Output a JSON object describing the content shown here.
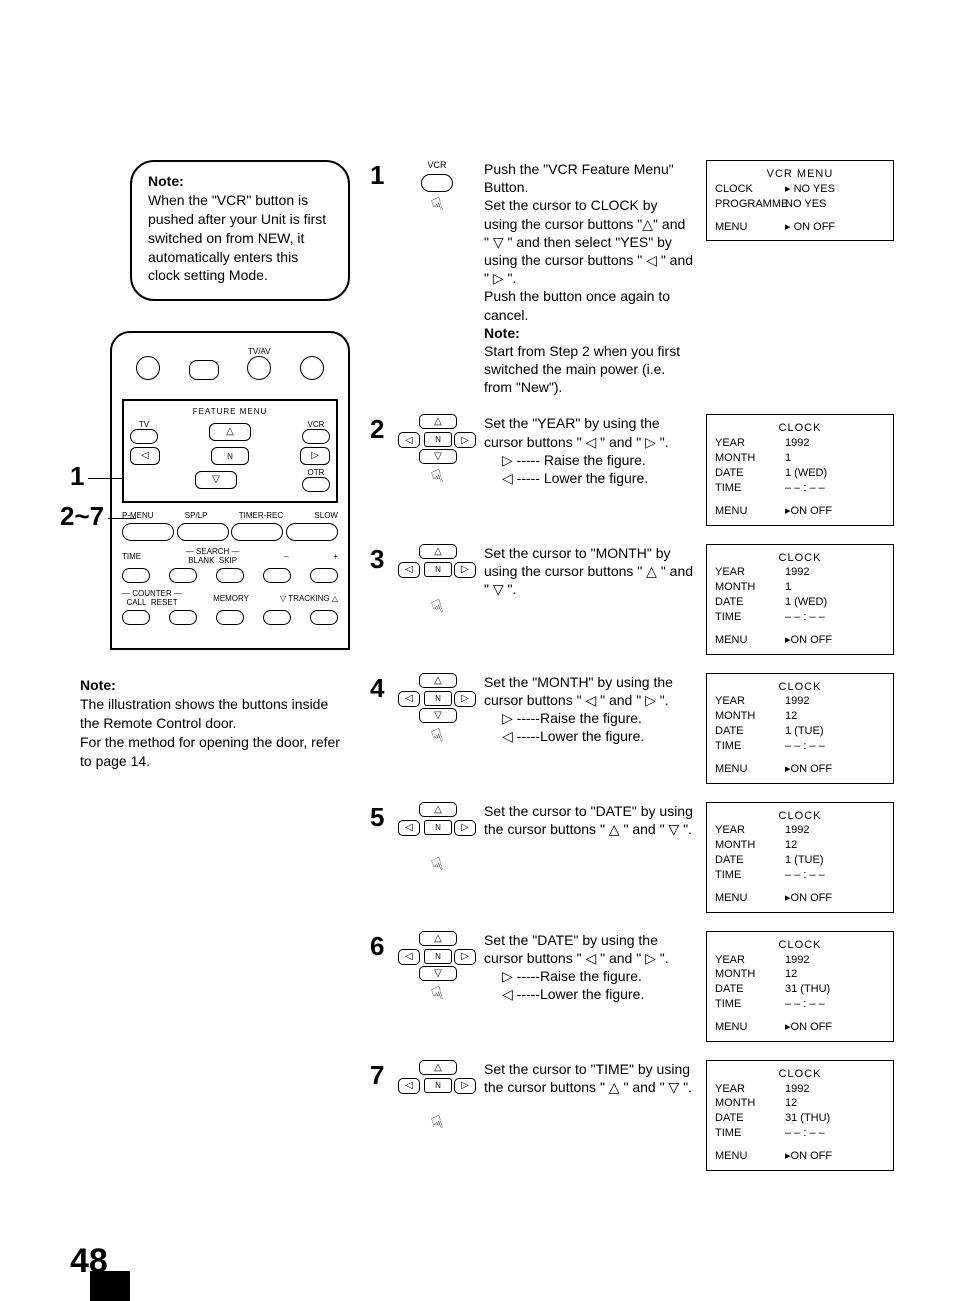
{
  "note_top": {
    "heading": "Note:",
    "body": "When the \"VCR\" button is pushed after your Unit is first switched on from NEW, it automatically enters this clock setting Mode."
  },
  "remote": {
    "tvav": "TV/AV",
    "feature_menu": "FEATURE MENU",
    "tv": "TV",
    "vcr": "VCR",
    "n": "N",
    "otr": "OTR",
    "pmenu": "P-MENU",
    "splp": "SP/LP",
    "timerrec": "TIMER-REC",
    "slow": "SLOW",
    "search": "SEARCH",
    "time": "TIME",
    "blank": "BLANK",
    "skip": "SKIP",
    "counter": "COUNTER",
    "call": "CALL",
    "reset": "RESET",
    "memory": "MEMORY",
    "tracking": "▽ TRACKING △"
  },
  "callout1": "1",
  "callout27": "2~7",
  "lower_note": {
    "heading": "Note:",
    "l1": "The illustration shows the buttons inside the Remote Control door.",
    "l2": "For the method for opening the door, refer to page 14."
  },
  "steps": {
    "s1": {
      "num": "1",
      "icon_label": "VCR",
      "text": "Push the \"VCR Feature Menu\" Button.\nSet the cursor to CLOCK by using the cursor buttons \"△\" and \" ▽ \" and then select \"YES\" by using the cursor buttons \" ◁ \" and \" ▷ \".\nPush the button once again to cancel.",
      "note_h": "Note:",
      "note": "Start from Step 2 when you first switched the main power (i.e. from \"New\")."
    },
    "s2": {
      "num": "2",
      "text": "Set the \"YEAR\" by using the cursor buttons \" ◁ \" and \" ▷ \".",
      "raise": "▷ ----- Raise the figure.",
      "lower": "◁ ----- Lower the figure."
    },
    "s3": {
      "num": "3",
      "text": "Set the cursor to \"MONTH\" by using the cursor buttons \" △ \" and \" ▽ \"."
    },
    "s4": {
      "num": "4",
      "text": "Set the \"MONTH\" by using the cursor buttons \" ◁ \" and \" ▷ \".",
      "raise": "▷ -----Raise the figure.",
      "lower": "◁ -----Lower the figure."
    },
    "s5": {
      "num": "5",
      "text": "Set the cursor to \"DATE\" by using the cursor buttons \" △ \" and \" ▽ \"."
    },
    "s6": {
      "num": "6",
      "text": "Set the \"DATE\" by using the cursor buttons \" ◁ \" and \" ▷ \".",
      "raise": "▷ -----Raise the figure.",
      "lower": "◁ -----Lower the figure."
    },
    "s7": {
      "num": "7",
      "text": "Set the cursor to \"TIME\" by using the cursor buttons \" △ \" and \" ▽ \"."
    }
  },
  "osd": {
    "s1": {
      "title": "VCR MENU",
      "r1l": "CLOCK",
      "r1v": "▸ NO  YES",
      "r2l": "PROGRAMME",
      "r2v": "  NO  YES",
      "menu_l": "MENU",
      "menu_v": "▸ ON  OFF"
    },
    "s2": {
      "title": "CLOCK",
      "year_l": "YEAR",
      "year_v": "1992",
      "month_l": "MONTH",
      "month_v": "1",
      "date_l": "DATE",
      "date_v": "1 (WED)",
      "time_l": "TIME",
      "time_v": "– – : – –",
      "menu_l": "MENU",
      "menu_v": "▸ON OFF"
    },
    "s3": {
      "title": "CLOCK",
      "year_l": "YEAR",
      "year_v": "1992",
      "month_l": "MONTH",
      "month_v": "1",
      "date_l": "DATE",
      "date_v": "1 (WED)",
      "time_l": "TIME",
      "time_v": "– – : – –",
      "menu_l": "MENU",
      "menu_v": "▸ON OFF"
    },
    "s4": {
      "title": "CLOCK",
      "year_l": "YEAR",
      "year_v": "1992",
      "month_l": "MONTH",
      "month_v": "12",
      "date_l": "DATE",
      "date_v": "1 (TUE)",
      "time_l": "TIME",
      "time_v": "– – : – –",
      "menu_l": "MENU",
      "menu_v": "▸ON OFF"
    },
    "s5": {
      "title": "CLOCK",
      "year_l": "YEAR",
      "year_v": "1992",
      "month_l": "MONTH",
      "month_v": "12",
      "date_l": "DATE",
      "date_v": "1 (TUE)",
      "time_l": "TIME",
      "time_v": "– – : – –",
      "menu_l": "MENU",
      "menu_v": "▸ON OFF"
    },
    "s6": {
      "title": "CLOCK",
      "year_l": "YEAR",
      "year_v": "1992",
      "month_l": "MONTH",
      "month_v": "12",
      "date_l": "DATE",
      "date_v": "31 (THU)",
      "time_l": "TIME",
      "time_v": "– – : – –",
      "menu_l": "MENU",
      "menu_v": "▸ON OFF"
    },
    "s7": {
      "title": "CLOCK",
      "year_l": "YEAR",
      "year_v": "1992",
      "month_l": "MONTH",
      "month_v": "12",
      "date_l": "DATE",
      "date_v": "31 (THU)",
      "time_l": "TIME",
      "time_v": "– – : – –",
      "menu_l": "MENU",
      "menu_v": "▸ON OFF"
    }
  },
  "page_number": "48",
  "nav_n": "N"
}
